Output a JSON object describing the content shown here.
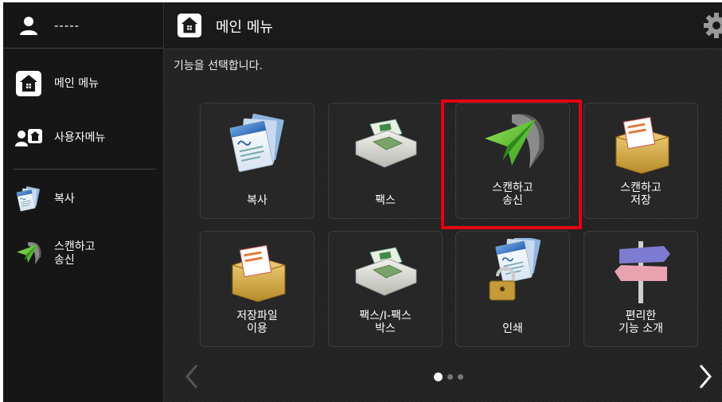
{
  "sidebar": {
    "user_name": "-----",
    "items": [
      {
        "label": "메인 메뉴",
        "icon": "home-icon"
      },
      {
        "label": "사용자메뉴",
        "icon": "user-menu-icon"
      },
      {
        "label": "복사",
        "icon": "copy-icon"
      },
      {
        "label": "스캔하고\n송신",
        "icon": "scan-send-icon"
      }
    ]
  },
  "header": {
    "title": "메인 메뉴",
    "icon": "home-icon",
    "settings_icon": "gear-icon"
  },
  "main": {
    "instruction": "기능을 선택합니다.",
    "tiles": [
      {
        "label": "복사",
        "icon": "copy-icon"
      },
      {
        "label": "팩스",
        "icon": "fax-icon"
      },
      {
        "label": "스캔하고\n송신",
        "icon": "scan-send-icon"
      },
      {
        "label": "스캔하고\n저장",
        "icon": "scan-store-icon"
      },
      {
        "label": "저장파일\n이용",
        "icon": "stored-files-icon"
      },
      {
        "label": "팩스/I-팩스\n박스",
        "icon": "fax-box-icon"
      },
      {
        "label": "인쇄",
        "icon": "secure-print-icon"
      },
      {
        "label": "편리한\n기능 소개",
        "icon": "signpost-icon"
      }
    ],
    "highlight_color": "#e60012",
    "page_count": 3,
    "current_page": 1
  },
  "colors": {
    "background": "#1c1c1c",
    "tile": "#272727",
    "accent_green": "#4caf2a"
  }
}
